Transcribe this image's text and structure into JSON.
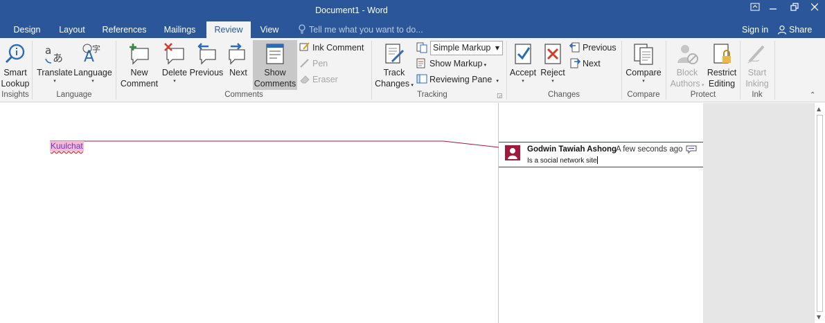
{
  "title_bar": {
    "document_title": "Document1 - Word",
    "controls": [
      "ribbon-display-options",
      "minimize",
      "restore",
      "close"
    ]
  },
  "tabs": [
    {
      "label": "Design"
    },
    {
      "label": "Layout"
    },
    {
      "label": "References"
    },
    {
      "label": "Mailings"
    },
    {
      "label": "Review",
      "active": true
    },
    {
      "label": "View"
    }
  ],
  "tell_me": {
    "placeholder": "Tell me what you want to do..."
  },
  "account": {
    "sign_in": "Sign in",
    "share": "Share"
  },
  "ribbon": {
    "insights": {
      "group_label": "Insights",
      "smart_lookup_line1": "Smart",
      "smart_lookup_line2": "Lookup"
    },
    "language": {
      "group_label": "Language",
      "translate": "Translate",
      "language": "Language"
    },
    "comments": {
      "group_label": "Comments",
      "new_comment_line1": "New",
      "new_comment_line2": "Comment",
      "delete": "Delete",
      "previous": "Previous",
      "next": "Next",
      "show_comments_line1": "Show",
      "show_comments_line2": "Comments",
      "ink_comment": "Ink Comment",
      "pen": "Pen",
      "eraser": "Eraser"
    },
    "tracking": {
      "group_label": "Tracking",
      "track_changes_line1": "Track",
      "track_changes_line2": "Changes",
      "markup_selected": "Simple Markup",
      "show_markup": "Show Markup",
      "reviewing_pane": "Reviewing Pane"
    },
    "changes": {
      "group_label": "Changes",
      "accept": "Accept",
      "reject": "Reject",
      "previous": "Previous",
      "next": "Next"
    },
    "compare": {
      "group_label": "Compare",
      "compare": "Compare"
    },
    "protect": {
      "group_label": "Protect",
      "block_authors_line1": "Block",
      "block_authors_line2": "Authors",
      "restrict_editing_line1": "Restrict",
      "restrict_editing_line2": "Editing"
    },
    "ink": {
      "group_label": "Ink",
      "start_inking_line1": "Start",
      "start_inking_line2": "Inking"
    }
  },
  "document": {
    "commented_text": "Kuulchat"
  },
  "comment": {
    "author": "Godwin Tawiah Ashong",
    "time": "A few seconds ago",
    "text": "Is a social network site"
  },
  "colors": {
    "title_bar": "#2b579a",
    "ribbon": "#f3f3f3",
    "comment_accent": "#a4173d",
    "highlight": "#f3bcd3"
  }
}
